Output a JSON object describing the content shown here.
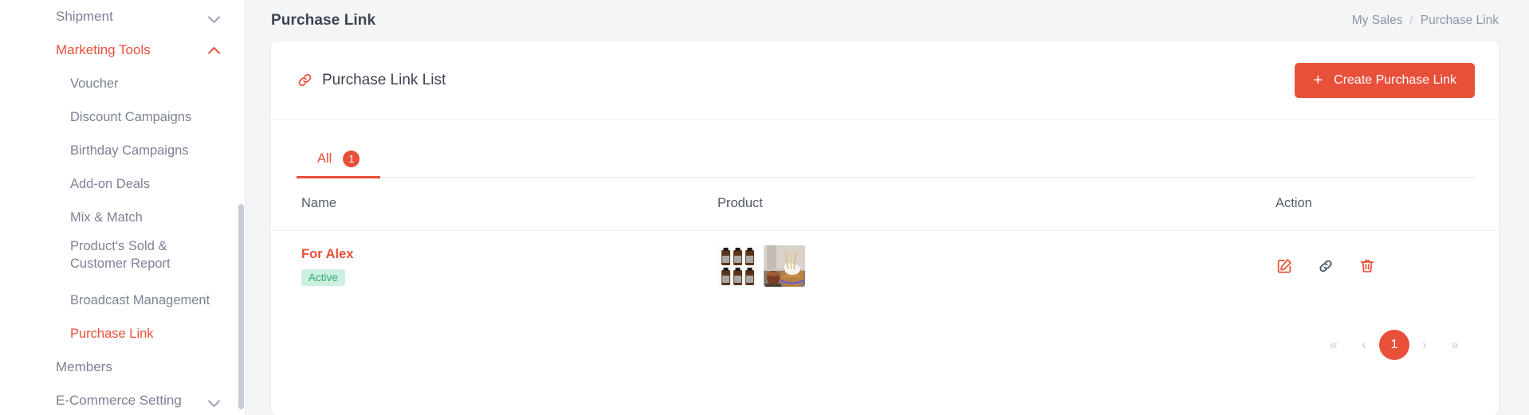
{
  "sidebar": {
    "items": [
      {
        "label": "Shipment",
        "level": "top",
        "state": "collapsed",
        "active": false
      },
      {
        "label": "Marketing Tools",
        "level": "top",
        "state": "expanded",
        "active": true
      },
      {
        "label": "Voucher",
        "level": "sub",
        "active": false
      },
      {
        "label": "Discount Campaigns",
        "level": "sub",
        "active": false
      },
      {
        "label": "Birthday Campaigns",
        "level": "sub",
        "active": false
      },
      {
        "label": "Add-on Deals",
        "level": "sub",
        "active": false
      },
      {
        "label": "Mix & Match",
        "level": "sub",
        "active": false
      },
      {
        "label": "Product's Sold & Customer Report",
        "level": "sub",
        "active": false
      },
      {
        "label": "Broadcast Management",
        "level": "sub",
        "active": false
      },
      {
        "label": "Purchase Link",
        "level": "sub",
        "active": true
      },
      {
        "label": "Members",
        "level": "top",
        "state": "none",
        "active": false
      },
      {
        "label": "E-Commerce Setting",
        "level": "top",
        "state": "collapsed",
        "active": false
      }
    ]
  },
  "header": {
    "title": "Purchase Link",
    "breadcrumb": {
      "parent": "My Sales",
      "separator": "/",
      "current": "Purchase Link"
    }
  },
  "card": {
    "title": "Purchase Link List",
    "create_button": {
      "plus": "+",
      "label": "Create Purchase Link"
    }
  },
  "tabs": [
    {
      "label": "All",
      "badge": "1",
      "active": true
    }
  ],
  "table": {
    "columns": [
      "Name",
      "Product",
      "Action"
    ],
    "rows": [
      {
        "name": "For Alex",
        "status": "Active",
        "products": [
          "essential-oil-bottles-thumbnail",
          "wooden-diffuser-thumbnail"
        ],
        "actions": [
          "edit-icon",
          "copy-link-icon",
          "delete-icon"
        ]
      }
    ]
  },
  "pagination": {
    "first": "«",
    "prev": "‹",
    "pages": [
      "1"
    ],
    "next": "›",
    "last": "»",
    "current": "1"
  },
  "colors": {
    "accent": "#e8503a",
    "page_bg": "#f4f5f7",
    "card_bg": "#ffffff",
    "text_muted": "#8d94a3",
    "text_dark": "#3d4450",
    "status_green_text": "#34a878",
    "status_green_bg": "#ccf0df",
    "link_icon_dark": "#3f5068"
  }
}
